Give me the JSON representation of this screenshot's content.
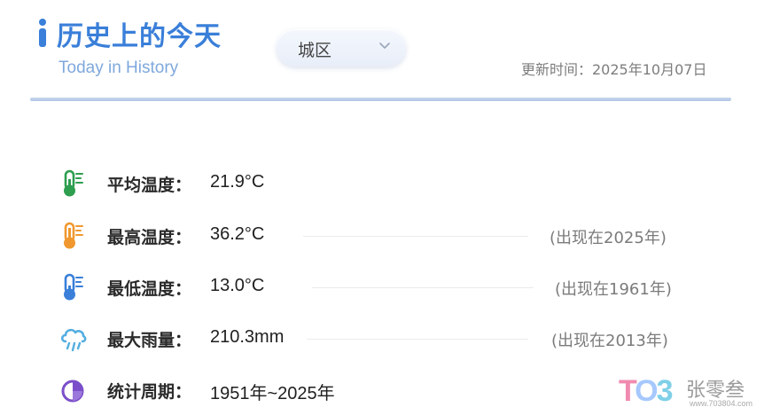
{
  "header": {
    "title": "历史上的今天",
    "subtitle": "Today in History",
    "region": "城区",
    "updated": "更新时间：2025年10月07日"
  },
  "stats": [
    {
      "icon": "thermometer-green-icon",
      "label": "平均温度：",
      "value": "21.9°C",
      "note": ""
    },
    {
      "icon": "thermometer-orange-icon",
      "label": "最高温度：",
      "value": "36.2°C",
      "note": "(出现在2025年)"
    },
    {
      "icon": "thermometer-blue-icon",
      "label": "最低温度：",
      "value": "13.0°C",
      "note": "(出现在1961年)"
    },
    {
      "icon": "rain-cloud-icon",
      "label": "最大雨量：",
      "value": "210.3mm",
      "note": "(出现在2013年)"
    },
    {
      "icon": "pie-chart-icon",
      "label": "统计周期：",
      "value": "1951年~2025年",
      "note": ""
    }
  ],
  "watermark": {
    "mark": [
      "T",
      "O",
      "3"
    ],
    "text": "张零叁",
    "url": "www.703804.com"
  },
  "colors": {
    "accent": "#3a7fd9",
    "subtitle": "#7fa8dc",
    "thermo_green": "#2e9e4f",
    "thermo_orange": "#f0982f",
    "thermo_blue": "#3a7fd9",
    "rain": "#54aee0",
    "pie": "#7b4fc9"
  }
}
